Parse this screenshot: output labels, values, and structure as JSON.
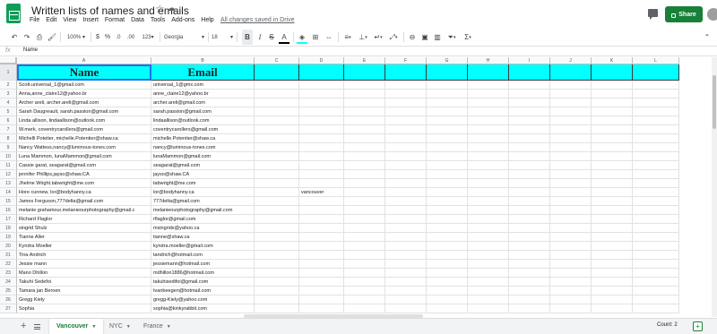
{
  "titlebar": {
    "doc_title": "Written lists of names and emails",
    "saved_status": "All changes saved in Drive",
    "share_label": "Share",
    "menu": [
      "File",
      "Edit",
      "View",
      "Insert",
      "Format",
      "Data",
      "Tools",
      "Add-ons",
      "Help"
    ]
  },
  "toolbar": {
    "zoom": "100%",
    "currency": "$",
    "percent": "%",
    "dec_decrease": ".0",
    "dec_increase": ".00",
    "more_formats": "123",
    "font": "Georgia",
    "font_size": "18",
    "bold": "B",
    "italic": "I",
    "strike": "S",
    "text_color": "A",
    "text_color_value": "#000000",
    "fill_color_value": "#00ffff",
    "sigma": "Σ"
  },
  "formula_bar": {
    "fx": "fx",
    "value": "Name"
  },
  "grid": {
    "columns": [
      "A",
      "B",
      "C",
      "D",
      "E",
      "F",
      "G",
      "H",
      "I",
      "J",
      "K",
      "L"
    ],
    "header_fill": "#00ffff",
    "header_row": {
      "num": "1",
      "name": "Name",
      "email": "Email"
    },
    "rows": [
      {
        "num": "2",
        "a": "Scott.universal_1@gmail.com",
        "b": "universal_1@gmx.com",
        "d": ""
      },
      {
        "num": "3",
        "a": "Anna,anne_claire12@yahoo.br",
        "b": "anne_claire12@yahoo.br",
        "d": ""
      },
      {
        "num": "4",
        "a": "Archer areli, archer.areli@gmail.com",
        "b": "archer.areli@gmail.com",
        "d": ""
      },
      {
        "num": "5",
        "a": "Sarah Daugreault, sarah.passion@gmail.com",
        "b": "sarah.passion@gmail.com",
        "d": ""
      },
      {
        "num": "6",
        "a": "Linda allison, lindaallison@outlook.com",
        "b": "lindaallison@outlook.com",
        "d": ""
      },
      {
        "num": "7",
        "a": "W.merk, coventrycarollers@gmail.com",
        "b": "coventrycarollers@gmail.com",
        "d": ""
      },
      {
        "num": "8",
        "a": "Michelli Potetier, michelle.Potentier@shaw.ca",
        "b": "michelle.Potentier@shaw.ca",
        "d": ""
      },
      {
        "num": "9",
        "a": "Nancy Wattess,nancy@luminous-tones.com",
        "b": "nancy@luminous-tones.com",
        "d": ""
      },
      {
        "num": "10",
        "a": "Luna Mammon, lunaMammon@gmail.com",
        "b": "lunaMammon@gmail.com",
        "d": ""
      },
      {
        "num": "11",
        "a": "Cassie garat, seagarat@gmail.com",
        "b": "seagarat@gmail.com",
        "d": ""
      },
      {
        "num": "12",
        "a": "jennifer Phillips,jayso@shaw.CA",
        "b": "jayso@shaw.CA",
        "d": ""
      },
      {
        "num": "13",
        "a": "Jhelme Wright.tabwright@me.com",
        "b": "tabwright@me.com",
        "d": ""
      },
      {
        "num": "14",
        "a": "Hore cunnew, lor@bodyhanny.ca",
        "b": "lor@bodyhanny.ca",
        "d": "vancouver"
      },
      {
        "num": "15",
        "a": "James Ferguson,777delta@gmail.com",
        "b": "777delta@gmail.com",
        "d": ""
      },
      {
        "num": "16",
        "a": "melanie grahamour,melanieourphotography@gmail.c",
        "b": "melanieourphotography@gmail.com",
        "d": ""
      },
      {
        "num": "17",
        "a": "Richard Flaglor",
        "b": "rflaglor@gmail.com",
        "d": ""
      },
      {
        "num": "18",
        "a": "singrid Shulz",
        "b": "msingrids@yahoo.ca",
        "d": ""
      },
      {
        "num": "19",
        "a": "Tianne Aller",
        "b": "tianne@shaw.ca",
        "d": ""
      },
      {
        "num": "20",
        "a": "Kyndra Moeller",
        "b": "kyndra.moeller@gmail.com",
        "d": ""
      },
      {
        "num": "21",
        "a": "Tina Andrich",
        "b": "tandrich@hotmail.com",
        "d": ""
      },
      {
        "num": "22",
        "a": "Jessie mann",
        "b": "jessiemann@hotmail.com",
        "d": ""
      },
      {
        "num": "23",
        "a": "Mano Dhillon",
        "b": "mdhillon1886@hotmail.com",
        "d": ""
      },
      {
        "num": "24",
        "a": "Takuhi Sedefoi",
        "b": "takuhisedifoi@gmail.com",
        "d": ""
      },
      {
        "num": "25",
        "a": "Tamara jan Beroen",
        "b": "tvanbeegen@hotmail.com",
        "d": ""
      },
      {
        "num": "26",
        "a": "Gregg Kiely",
        "b": "gregg-Kiely@yahoo.com",
        "d": ""
      },
      {
        "num": "27",
        "a": "Sophia",
        "b": "sophia@kinkyrabbit.com",
        "d": ""
      }
    ]
  },
  "sheets": {
    "tabs": [
      {
        "label": "Vancouver",
        "active": true
      },
      {
        "label": "NYC",
        "active": false
      },
      {
        "label": "France",
        "active": false
      }
    ],
    "add_label": "+",
    "status": "Count: 2"
  }
}
